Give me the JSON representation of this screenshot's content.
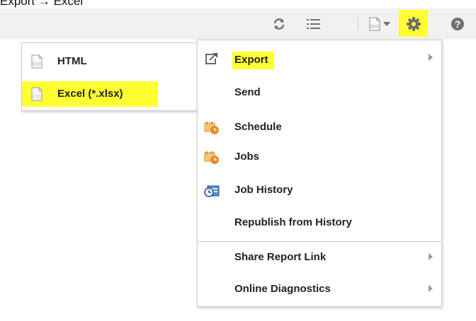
{
  "caption": "Export → Excel",
  "toolbar": {
    "icons": [
      "refresh-icon",
      "list-icon",
      "document-format-icon",
      "chevron-down-icon",
      "gear-icon",
      "help-icon"
    ],
    "highlight_color": "#ffff33"
  },
  "export_submenu": {
    "items": [
      {
        "label": "HTML",
        "icon": "html-file-icon"
      },
      {
        "label": "Excel (*.xlsx)",
        "icon": "excel-file-icon",
        "highlighted": true
      }
    ]
  },
  "actions_menu": {
    "items": [
      {
        "label": "Export",
        "icon": "export-icon",
        "has_submenu": true,
        "highlighted": true
      },
      {
        "label": "Send"
      },
      {
        "label": "Schedule",
        "icon": "schedule-icon"
      },
      {
        "label": "Jobs",
        "icon": "jobs-icon"
      },
      {
        "label": "Job History",
        "icon": "job-history-icon"
      },
      {
        "label": "Republish from History"
      },
      {
        "label": "Share Report Link",
        "has_submenu": true
      },
      {
        "label": "Online Diagnostics",
        "has_submenu": true
      }
    ]
  },
  "colors": {
    "highlight": "#ffff33",
    "icon_orange": "#f0a030",
    "icon_blue": "#2a6db5"
  }
}
